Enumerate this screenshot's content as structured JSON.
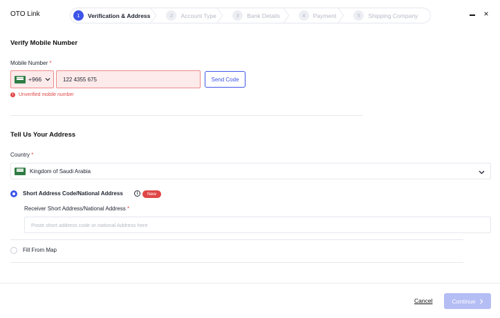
{
  "app": {
    "title": "OTO Link"
  },
  "stepper": {
    "steps": [
      {
        "num": "1",
        "label": "Verification & Address"
      },
      {
        "num": "2",
        "label": "Account Type"
      },
      {
        "num": "3",
        "label": "Bank Details"
      },
      {
        "num": "4",
        "label": "Payment"
      },
      {
        "num": "5",
        "label": "Shipping Company"
      }
    ],
    "active_step": 1
  },
  "window": {
    "close_glyph": "×"
  },
  "verify": {
    "section_title": "Verify Mobile Number",
    "mobile_label": "Mobile Number",
    "required_mark": "*",
    "country_code": "+966",
    "phone_value": "122 4355 675",
    "send_code_label": "Send Code",
    "error_icon": "!",
    "error_text": "Unverified mobile number"
  },
  "address": {
    "section_title": "Tell Us Your Address",
    "country_label": "Country",
    "country_value": "Kingdom of Saudi Arabia",
    "options": {
      "short_address": {
        "label": "Short Address Code/National Address",
        "selected": true,
        "badge": "New",
        "info_glyph": "i"
      },
      "fill_from_map": {
        "label": "Fill From Map",
        "selected": false
      }
    },
    "receiver_label": "Receiver Short Address/National Address",
    "receiver_placeholder": "Poste short address code or national Address here"
  },
  "footer": {
    "cancel_label": "Cancel",
    "continue_label": "Continue"
  },
  "colors": {
    "accent": "#3d54e8",
    "error": "#e04646",
    "flag_green": "#2f7d43",
    "continue_disabled": "#b5bdf5"
  },
  "icons": [
    "saudi-flag-icon",
    "chevron-down-icon",
    "close-icon",
    "minimize-icon",
    "info-icon",
    "error-icon",
    "chevron-right-icon"
  ]
}
